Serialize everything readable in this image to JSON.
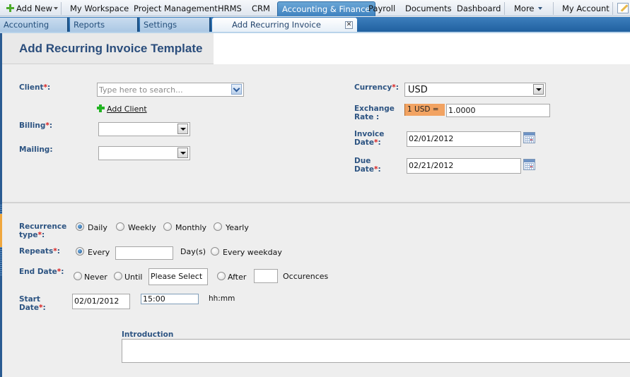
{
  "topnav": {
    "add_new": "Add New",
    "items": [
      "My Workspace",
      "Project Management",
      "HRMS",
      "CRM",
      "Accounting & Finance",
      "Payroll",
      "Documents",
      "Dashboard"
    ],
    "more": "More",
    "my_account": "My Account",
    "active_item": "Accounting & Finance"
  },
  "subtabs": {
    "items": [
      "Accounting",
      "Reports",
      "Settings"
    ],
    "current": "Add Recurring Invoice Template",
    "close_glyph": "✕"
  },
  "page": {
    "title": "Add Recurring Invoice Template"
  },
  "form": {
    "client": {
      "label": "Client",
      "placeholder": "Type here to search...",
      "value": ""
    },
    "add_client": "Add Client",
    "billing": {
      "label": "Billing",
      "value": ""
    },
    "mailing": {
      "label": "Mailing:",
      "value": ""
    },
    "currency": {
      "label": "Currency",
      "value": "USD"
    },
    "exchange_rate": {
      "label_1": "Exchange",
      "label_2": "Rate :",
      "prefix": "1 USD =",
      "value": "1.0000"
    },
    "invoice_date": {
      "label_1": "Invoice",
      "label_2": "Date",
      "value": "02/01/2012"
    },
    "due_date": {
      "label_1": "Due",
      "label_2": "Date",
      "value": "02/21/2012"
    },
    "recurrence_type": {
      "label_1": "Recurrence",
      "label_2": "type",
      "options": [
        "Daily",
        "Weekly",
        "Monthly",
        "Yearly"
      ],
      "selected": "Daily"
    },
    "repeats": {
      "label": "Repeats",
      "every_label": "Every",
      "every_value": "",
      "unit": "Day(s)",
      "weekday_label": "Every weekday",
      "selected": "Every"
    },
    "end_date": {
      "label": "End Date",
      "never": "Never",
      "until": "Until",
      "until_value": "Please Select",
      "after": "After",
      "after_value": "",
      "occurrences": "Occurences",
      "selected": ""
    },
    "start_date": {
      "label_1": "Start",
      "label_2": "Date",
      "date": "02/01/2012",
      "time": "15:00",
      "time_format": "hh:mm"
    },
    "introduction": {
      "label": "Introduction",
      "value": ""
    },
    "required_mark": "*",
    "colon": ":"
  },
  "colors": {
    "nav_active": "#3f82bf",
    "label": "#2d5482",
    "required": "#d81f1f",
    "rate_prefix_bg": "#f2a362"
  }
}
